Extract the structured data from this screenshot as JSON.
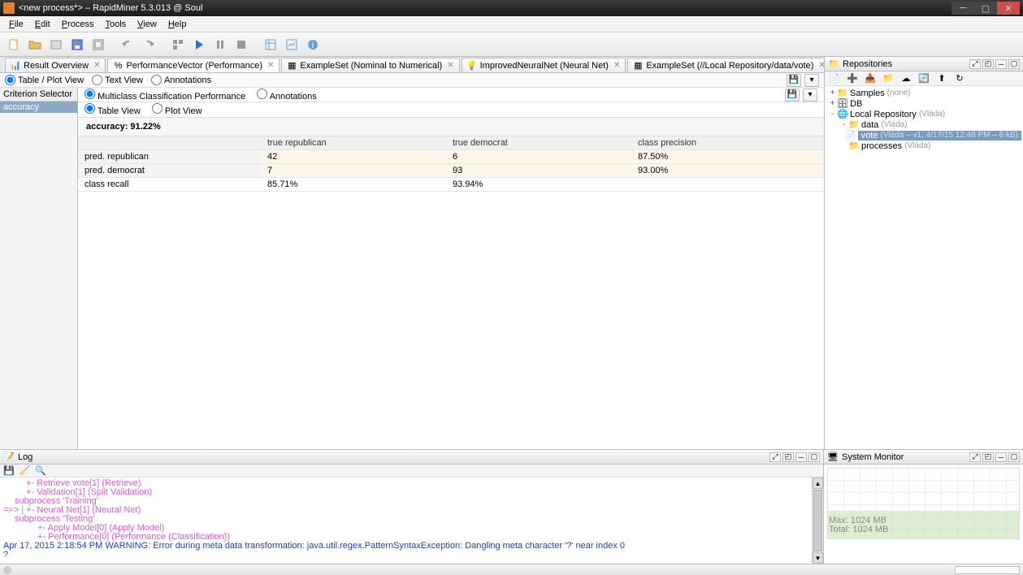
{
  "window": {
    "title": "<new process*> – RapidMiner 5.3.013 @ Soul"
  },
  "menu": [
    "File",
    "Edit",
    "Process",
    "Tools",
    "View",
    "Help"
  ],
  "tabs": [
    {
      "label": "Result Overview",
      "active": false
    },
    {
      "label": "PerformanceVector (Performance)",
      "active": true
    },
    {
      "label": "ExampleSet (Nominal to Numerical)",
      "active": false
    },
    {
      "label": "ImprovedNeuralNet (Neural Net)",
      "active": false
    },
    {
      "label": "ExampleSet (//Local Repository/data/vote)",
      "active": false
    }
  ],
  "view_radios": {
    "table_plot": "Table / Plot View",
    "text": "Text View",
    "annotations": "Annotations"
  },
  "criterion": {
    "header": "Criterion Selector",
    "item": "accuracy"
  },
  "perf_radios": {
    "multiclass": "Multiclass Classification Performance",
    "annotations": "Annotations"
  },
  "view2_radios": {
    "table": "Table View",
    "plot": "Plot View"
  },
  "accuracy_label": "accuracy: 91.22%",
  "conf_matrix": {
    "cols": [
      "",
      "true republican",
      "true democrat",
      "class precision"
    ],
    "rows": [
      [
        "pred. republican",
        "42",
        "6",
        "87.50%"
      ],
      [
        "pred. democrat",
        "7",
        "93",
        "93.00%"
      ],
      [
        "class recall",
        "85.71%",
        "93.94%",
        ""
      ]
    ]
  },
  "repos": {
    "title": "Repositories",
    "tree": [
      {
        "indent": 0,
        "toggle": "+",
        "icon": "folder",
        "label": "Samples",
        "meta": "(none)"
      },
      {
        "indent": 0,
        "toggle": "+",
        "icon": "db",
        "label": "DB",
        "meta": ""
      },
      {
        "indent": 0,
        "toggle": "-",
        "icon": "repo",
        "label": "Local Repository",
        "meta": "(Vláda)"
      },
      {
        "indent": 1,
        "toggle": "-",
        "icon": "folder",
        "label": "data",
        "meta": "(Vláda)"
      },
      {
        "indent": 2,
        "toggle": "",
        "icon": "file",
        "label": "vote",
        "meta": "(Vláda – v1, 4/17/15 12:48 PM – 6 kB)",
        "selected": true
      },
      {
        "indent": 1,
        "toggle": "",
        "icon": "folder",
        "label": "processes",
        "meta": "(Vláda)"
      }
    ]
  },
  "log": {
    "title": "Log",
    "lines": [
      {
        "cls": "pink",
        "indent": 2,
        "text": "+- Retrieve vote[1] (Retrieve)"
      },
      {
        "cls": "pink",
        "indent": 2,
        "text": "+- Validation[1] (Split Validation)"
      },
      {
        "cls": "pink",
        "indent": 1,
        "text": "subprocess 'Training'"
      },
      {
        "cls": "pink",
        "indent": 0,
        "text": "==>    |  +- Neural Net[1] (Neural Net)"
      },
      {
        "cls": "pink",
        "indent": 1,
        "text": "subprocess 'Testing'"
      },
      {
        "cls": "pink",
        "indent": 3,
        "text": "+- Apply Model[0] (Apply Model)"
      },
      {
        "cls": "pink",
        "indent": 3,
        "text": "+- Performance[0] (Performance (Classification))"
      },
      {
        "cls": "blue",
        "indent": 0,
        "text": "Apr 17, 2015 2:18:54 PM WARNING: Error during meta data transformation: java.util.regex.PatternSyntaxException: Dangling meta character '?' near index 0"
      },
      {
        "cls": "blue",
        "indent": 0,
        "text": "?"
      }
    ]
  },
  "monitor": {
    "title": "System Monitor",
    "max": "Max:   1024 MB",
    "total": "Total: 1024 MB"
  }
}
